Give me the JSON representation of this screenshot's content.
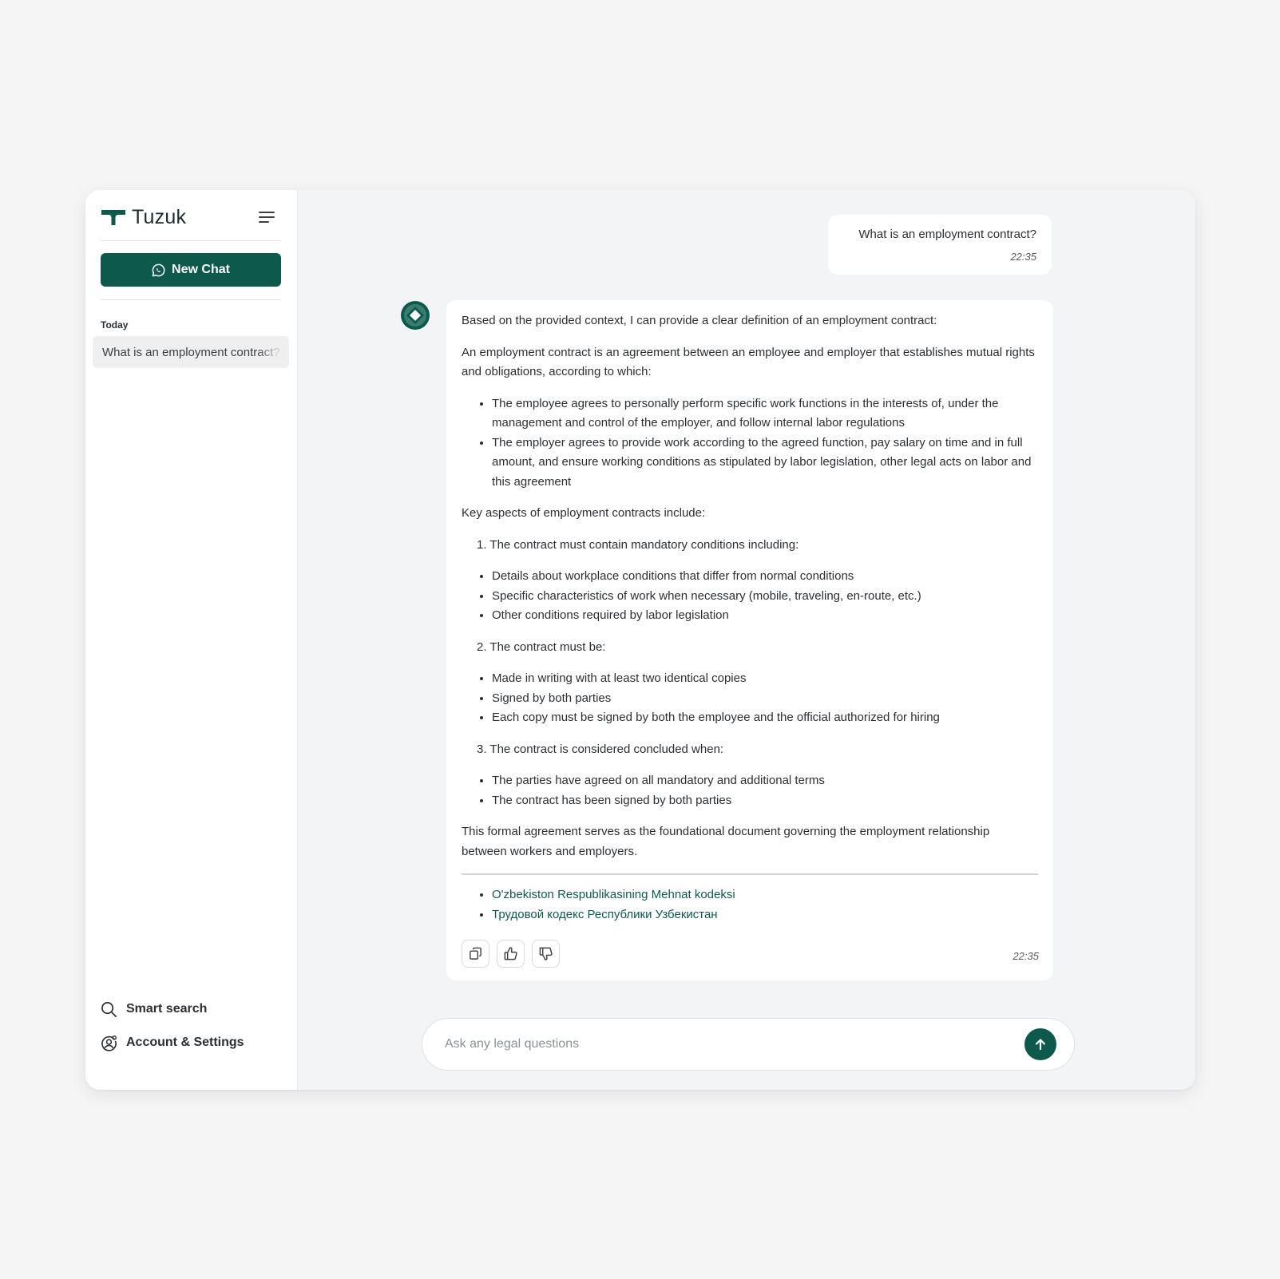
{
  "brand": {
    "name": "Tuzuk"
  },
  "sidebar": {
    "new_chat_label": "New Chat",
    "section_today": "Today",
    "history": [
      {
        "label": "What is an employment contract?"
      }
    ],
    "links": {
      "smart_search": "Smart search",
      "account_settings": "Account & Settings"
    }
  },
  "chat": {
    "user_message": {
      "text": "What is an employment contract?",
      "time": "22:35"
    },
    "bot_message": {
      "intro": "Based on the provided context, I can provide a clear definition of an employment contract:",
      "definition": "An employment contract is an agreement between an employee and employer that establishes mutual rights and obligations, according to which:",
      "obligations": [
        "The employee agrees to personally perform specific work functions in the interests of, under the management and control of the employer, and follow internal labor regulations",
        "The employer agrees to provide work according to the agreed function, pay salary on time and in full amount, and ensure working conditions as stipulated by labor legislation, other legal acts on labor and this agreement"
      ],
      "key_aspects_heading": "Key aspects of employment contracts include:",
      "sections": [
        {
          "heading": "1. The contract must contain mandatory conditions including:",
          "items": [
            "Details about workplace conditions that differ from normal conditions",
            "Specific characteristics of work when necessary (mobile, traveling, en-route, etc.)",
            "Other conditions required by labor legislation"
          ]
        },
        {
          "heading": "2. The contract must be:",
          "items": [
            "Made in writing with at least two identical copies",
            "Signed by both parties",
            "Each copy must be signed by both the employee and the official authorized for hiring"
          ]
        },
        {
          "heading": "3. The contract is considered concluded when:",
          "items": [
            "The parties have agreed on all mandatory and additional terms",
            "The contract has been signed by both parties"
          ]
        }
      ],
      "conclusion": "This formal agreement serves as the foundational document governing the employment relationship between workers and employers.",
      "sources": [
        "O'zbekiston Respublikasining Mehnat kodeksi",
        "Трудовой кодекс Республики Узбекистан"
      ],
      "time": "22:35"
    }
  },
  "composer": {
    "placeholder": "Ask any legal questions"
  },
  "icons": {
    "brand": "brand-logo-icon",
    "menu": "hamburger-menu-icon",
    "new_chat": "chat-bubble-icon",
    "search": "search-icon",
    "settings": "user-gear-icon",
    "copy": "copy-icon",
    "like": "thumbs-up-icon",
    "dislike": "thumbs-down-icon",
    "send": "arrow-up-icon",
    "bot": "bot-avatar-icon"
  },
  "colors": {
    "accent": "#0d5a4d",
    "background": "#f3f4f6"
  }
}
